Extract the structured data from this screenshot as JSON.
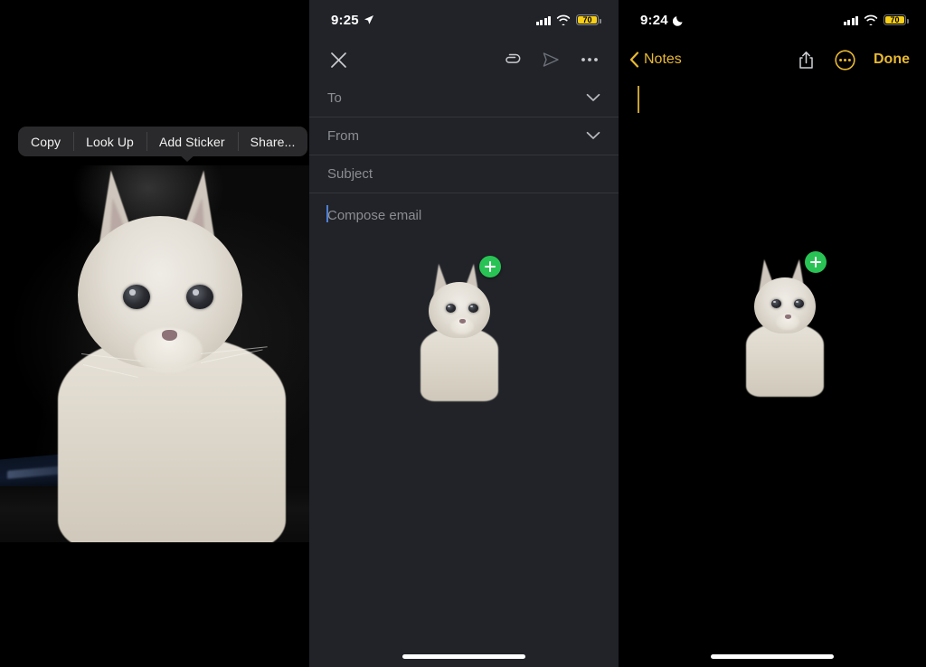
{
  "panels": {
    "photo": {
      "context_menu": {
        "items": [
          {
            "label": "Copy",
            "name": "copy"
          },
          {
            "label": "Look Up",
            "name": "look-up"
          },
          {
            "label": "Add Sticker",
            "name": "add-sticker"
          },
          {
            "label": "Share...",
            "name": "share"
          }
        ]
      },
      "subject": "white long-haired cat photo on dark background",
      "background_color": "#000000"
    },
    "mail": {
      "status_bar": {
        "time": "9:25",
        "location_icon": "location-arrow-icon",
        "cellular_icon": "cellular-signal-icon",
        "wifi_icon": "wifi-icon",
        "battery_percent": "70",
        "battery_color": "#f7cf18"
      },
      "toolbar": {
        "close_icon": "close-icon",
        "attach_icon": "paperclip-icon",
        "send_icon": "send-icon",
        "more_icon": "more-ellipsis-icon"
      },
      "fields": [
        {
          "label": "To",
          "name": "to-field",
          "chevron": "chevron-down-icon"
        },
        {
          "label": "From",
          "name": "from-field",
          "chevron": "chevron-down-icon"
        },
        {
          "label": "Subject",
          "name": "subject-field",
          "chevron": ""
        }
      ],
      "body_placeholder": "Compose email",
      "caret_color": "#4f7fd4",
      "background_color": "#212329",
      "dragged_sticker": {
        "badge_icon": "add-plus-badge-icon",
        "badge_color": "#29c355"
      }
    },
    "notes": {
      "status_bar": {
        "time": "9:24",
        "focus_icon": "crescent-moon-icon",
        "cellular_icon": "cellular-signal-icon",
        "wifi_icon": "wifi-icon",
        "battery_percent": "70",
        "battery_color": "#f7cf18"
      },
      "toolbar": {
        "back_icon": "chevron-left-icon",
        "back_label": "Notes",
        "share_icon": "share-icon",
        "more_icon": "more-circle-icon",
        "done_label": "Done",
        "accent_color": "#e8b931"
      },
      "caret_color": "#c8a12c",
      "background_color": "#000000",
      "dragged_sticker": {
        "badge_icon": "add-plus-badge-icon",
        "badge_color": "#29c355"
      }
    }
  }
}
